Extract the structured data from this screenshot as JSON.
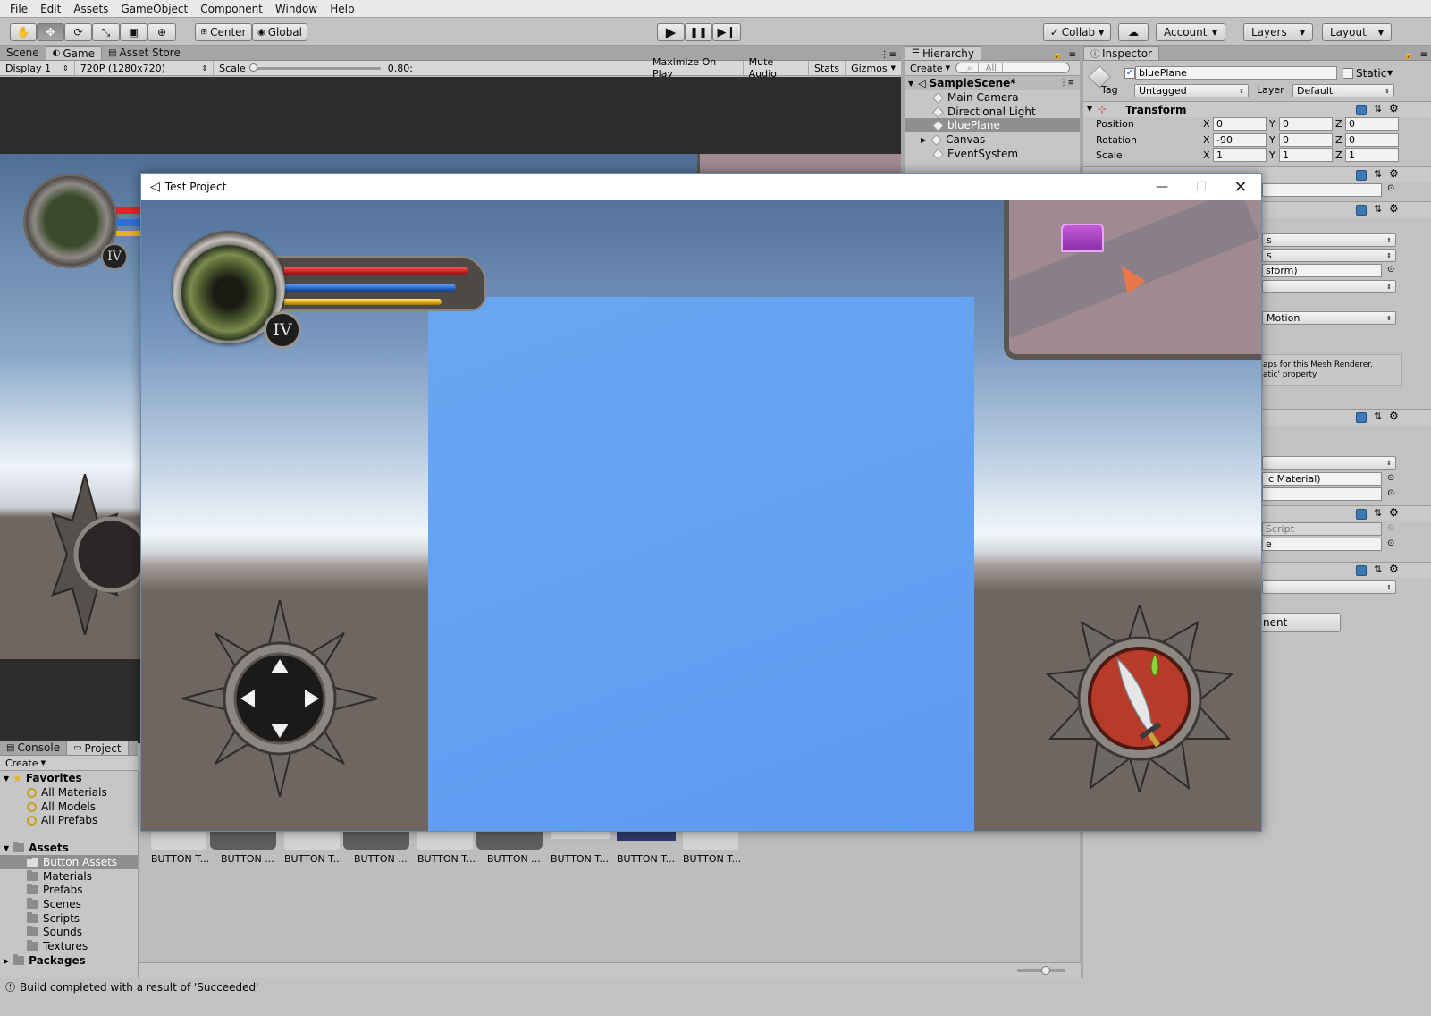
{
  "menu": [
    "File",
    "Edit",
    "Assets",
    "GameObject",
    "Component",
    "Window",
    "Help"
  ],
  "toolbar": {
    "pivot": "Center",
    "space": "Global",
    "collab": "Collab",
    "account": "Account",
    "layers": "Layers",
    "layout": "Layout"
  },
  "game_panel": {
    "tabs": [
      "Scene",
      "Game",
      "Asset Store"
    ],
    "display": "Display 1",
    "resolution": "720P (1280x720)",
    "scale_label": "Scale",
    "scale_value": "0.80:",
    "toggles": [
      "Maximize On Play",
      "Mute Audio",
      "Stats",
      "Gizmos"
    ]
  },
  "hierarchy": {
    "tab": "Hierarchy",
    "create": "Create",
    "search_placeholder": "All",
    "scene": "SampleScene*",
    "items": [
      "Main Camera",
      "Directional Light",
      "bluePlane",
      "Canvas",
      "EventSystem"
    ],
    "selected": "bluePlane"
  },
  "inspector": {
    "tab": "Inspector",
    "object_name": "bluePlane",
    "static_label": "Static",
    "tag_label": "Tag",
    "tag_value": "Untagged",
    "layer_label": "Layer",
    "layer_value": "Default",
    "transform_title": "Transform",
    "position_label": "Position",
    "rotation_label": "Rotation",
    "scale_label": "Scale",
    "position": {
      "x": "0",
      "y": "0",
      "z": "0"
    },
    "rotation": {
      "x": "-90",
      "y": "0",
      "z": "0"
    },
    "scale": {
      "x": "1",
      "y": "1",
      "z": "1"
    },
    "axis_x": "X",
    "axis_y": "Y",
    "axis_z": "Z",
    "partial": {
      "s1": "s",
      "s2": "s",
      "sform": "sform)",
      "motion": "Motion",
      "maps_text_1": "aps for this Mesh Renderer.",
      "maps_text_2": "atic' property.",
      "material": "ic Material)",
      "script": "Script",
      "e": "e",
      "nent": "nent"
    }
  },
  "project": {
    "tabs": [
      "Console",
      "Project"
    ],
    "create": "Create",
    "favorites_label": "Favorites",
    "favorites": [
      "All Materials",
      "All Models",
      "All Prefabs"
    ],
    "assets_label": "Assets",
    "folders": [
      "Button Assets",
      "Materials",
      "Prefabs",
      "Scenes",
      "Scripts",
      "Sounds",
      "Textures"
    ],
    "selected_folder": "Button Assets",
    "packages_label": "Packages",
    "grid_items": [
      "BUTTON T...",
      "BUTTON ...",
      "BUTTON T...",
      "BUTTON ...",
      "BUTTON T...",
      "BUTTON ...",
      "BUTTON T...",
      "BUTTON T...",
      "BUTTON T..."
    ]
  },
  "status": {
    "message": "Build completed with a result of 'Succeeded'"
  },
  "window": {
    "title": "Test Project",
    "level": "IV"
  },
  "colors": {
    "blue_plane": "#6aa4ef",
    "sky_top": "#4f6f98",
    "ground": "#6f6661",
    "hp_red": "#d8262a",
    "mp_blue": "#2f6fd6",
    "xp_yellow": "#e7b21c"
  }
}
